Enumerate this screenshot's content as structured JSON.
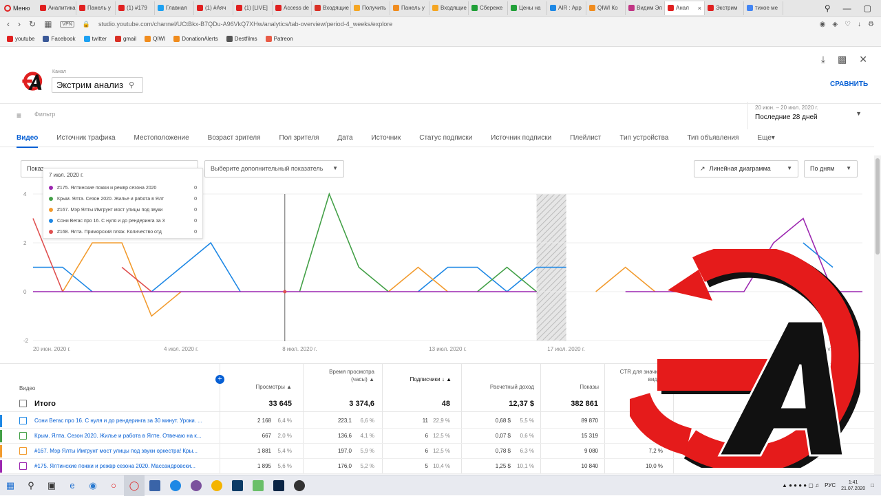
{
  "browser": {
    "menu_label": "Меню",
    "tabs": [
      {
        "label": "Аналитика",
        "color": "#e02020"
      },
      {
        "label": "Панель у",
        "color": "#e02020"
      },
      {
        "label": "(1) #179",
        "color": "#e02020"
      },
      {
        "label": "Главная",
        "color": "#1da1f2"
      },
      {
        "label": "(1) #Аяч",
        "color": "#e02020"
      },
      {
        "label": "(1) [LIVE]",
        "color": "#e02020"
      },
      {
        "label": "Access de",
        "color": "#e02020"
      },
      {
        "label": "Входящие",
        "color": "#d93025"
      },
      {
        "label": "Получить",
        "color": "#f5a623"
      },
      {
        "label": "Панель у",
        "color": "#f08c1e"
      },
      {
        "label": "Входящие",
        "color": "#f5a623"
      },
      {
        "label": "Сбереже",
        "color": "#21a038"
      },
      {
        "label": "Цены на",
        "color": "#21a038"
      },
      {
        "label": "AIR : App",
        "color": "#1e88e5"
      },
      {
        "label": "QIWI Ко",
        "color": "#f08c1e"
      },
      {
        "label": "Видим Эл",
        "color": "#c13584"
      },
      {
        "label": "Анал",
        "color": "#e02020",
        "active": true
      },
      {
        "label": "Экстрим",
        "color": "#e02020"
      },
      {
        "label": "тихое ме",
        "color": "#4285f4"
      }
    ],
    "url": "studio.youtube.com/channel/UCtBkx-B7QDu-A96VkQ7XHw/analytics/tab-overview/period-4_weeks/explore",
    "vpn_label": "VPN",
    "bookmarks": [
      {
        "label": "youtube",
        "color": "#e02020"
      },
      {
        "label": "Facebook",
        "color": "#3b5998"
      },
      {
        "label": "twitter",
        "color": "#1da1f2"
      },
      {
        "label": "gmail",
        "color": "#d93025"
      },
      {
        "label": "QIWI",
        "color": "#f08c1e"
      },
      {
        "label": "DonationAlerts",
        "color": "#f08c1e"
      },
      {
        "label": "Destfilms",
        "color": "#555555"
      },
      {
        "label": "Patreon",
        "color": "#e85b46"
      }
    ]
  },
  "studio": {
    "channel_label": "Канал",
    "channel_name": "Экстрим анализ",
    "compare_label": "СРАВНИТЬ",
    "filter_placeholder": "Фильтр",
    "date_range_sub": "20 июн. – 20 июл. 2020 г.",
    "date_range_main": "Последние 28 дней"
  },
  "dimension_tabs": [
    "Видео",
    "Источник трафика",
    "Местоположение",
    "Возраст зрителя",
    "Пол зрителя",
    "Дата",
    "Источник",
    "Статус подписки",
    "Источник подписки",
    "Плейлист",
    "Тип устройства",
    "Тип объявления",
    "Еще"
  ],
  "controls": {
    "metric": "Показ",
    "extra_metric": "Выберите дополнительный показатель",
    "chart_type": "Линейная диаграмма",
    "period": "По дням"
  },
  "tooltip": {
    "date": "7 июл. 2020 г.",
    "rows": [
      {
        "name": "#175. Ялтинские пожки и режвр сезона 2020",
        "value": "0",
        "color": "#9c27b0"
      },
      {
        "name": "Крым. Ялта. Сезон 2020. Жилье и работа в Ялт",
        "value": "0",
        "color": "#43a047"
      },
      {
        "name": "#167. Мэр Ялты Имгрунт мост улицы под звуки",
        "value": "0",
        "color": "#f29b2e"
      },
      {
        "name": "Сони Вегас про 16. С нуля и до рендеринга за 3",
        "value": "0",
        "color": "#1e88e5"
      },
      {
        "name": "#168. Ялта. Приморский пляж. Количество отд",
        "value": "0",
        "color": "#e05050"
      }
    ]
  },
  "chart_data": {
    "type": "line",
    "y_ticks": [
      "4",
      "2",
      "0",
      "-2"
    ],
    "ylim": [
      -2,
      4
    ],
    "x_tick_labels": [
      {
        "label": "20 июн. 2020 г.",
        "index": 0
      },
      {
        "label": "4 июл. 2020 г.",
        "index": 5
      },
      {
        "label": "8 июл. 2020 г.",
        "index": 9
      },
      {
        "label": "13 июл. 2020 г.",
        "index": 14
      },
      {
        "label": "17 июл. 2020 г.",
        "index": 18
      },
      {
        "label": "20 июл. 2020 г.",
        "index": 27
      }
    ],
    "hover_index": 8,
    "shaded_index": [
      17,
      18
    ],
    "series": [
      {
        "name": "Сони Вегас про 16",
        "color": "#1e88e5",
        "values": [
          1,
          1,
          0,
          null,
          0,
          1,
          2,
          0,
          null,
          null,
          null,
          null,
          null,
          0,
          1,
          1,
          0,
          1,
          1,
          null,
          null,
          null,
          null,
          null,
          null,
          null,
          2,
          1,
          null
        ]
      },
      {
        "name": "Крым. Ялта. Сезон 2020",
        "color": "#43a047",
        "values": [
          null,
          null,
          null,
          null,
          null,
          null,
          null,
          null,
          null,
          0,
          4,
          1,
          0,
          null,
          null,
          0,
          1,
          0,
          null,
          null,
          null,
          null,
          0,
          0,
          null,
          null,
          null,
          null,
          null
        ]
      },
      {
        "name": "#167. Мэр Ялты",
        "color": "#f29b2e",
        "values": [
          null,
          0,
          2,
          2,
          -1,
          0,
          null,
          null,
          null,
          null,
          null,
          null,
          0,
          1,
          0,
          null,
          null,
          null,
          null,
          0,
          1,
          0,
          null,
          null,
          null,
          null,
          null,
          null,
          null
        ]
      },
      {
        "name": "#168. Ялта. Приморский пляж",
        "color": "#e05050",
        "values": [
          3,
          0,
          null,
          1,
          0,
          null,
          null,
          null,
          null,
          null,
          null,
          null,
          null,
          null,
          null,
          null,
          null,
          null,
          null,
          null,
          null,
          null,
          null,
          null,
          null,
          null,
          null,
          null,
          null
        ]
      },
      {
        "name": "#175. Ялтинские пожки",
        "color": "#9c27b0",
        "values": [
          0,
          0,
          0,
          0,
          0,
          0,
          0,
          0,
          0,
          0,
          0,
          0,
          0,
          0,
          0,
          0,
          0,
          0,
          null,
          null,
          0,
          0,
          0,
          0,
          0,
          2,
          3,
          0,
          0
        ]
      }
    ]
  },
  "table": {
    "headers": {
      "video": "Видео",
      "views": "Просмотры",
      "watch_time": "Время просмотра (часы)",
      "subs": "Подписчики",
      "revenue": "Расчетный доход",
      "impressions": "Показы",
      "ctr": "CTR для значков видео"
    },
    "total": {
      "label": "Итого",
      "views": "33 645",
      "watch_time": "3 374,6",
      "subs": "48",
      "revenue": "12,37 $",
      "impressions": "382 861"
    },
    "rows": [
      {
        "title": "Сони Вегас про 16. С нуля и до рендеринга за 30 минут. Уроки. ...",
        "color": "#1e88e5",
        "views": "2 168",
        "views_pct": "6,4 %",
        "wt": "223,1",
        "wt_pct": "6,6 %",
        "subs": "11",
        "subs_pct": "22,9 %",
        "rev": "0,68 $",
        "rev_pct": "5,5 %",
        "imp": "89 870",
        "ctr": ""
      },
      {
        "title": "Крым. Ялта. Сезон 2020. Жилье и работа в Ялте. Отвечаю на к...",
        "color": "#43a047",
        "views": "667",
        "views_pct": "2,0 %",
        "wt": "136,6",
        "wt_pct": "4,1 %",
        "subs": "6",
        "subs_pct": "12,5 %",
        "rev": "0,07 $",
        "rev_pct": "0,6 %",
        "imp": "15 319",
        "ctr": ""
      },
      {
        "title": "#167. Мэр Ялты Имгрунт мост улицы под звуки оркестра! Кры...",
        "color": "#f29b2e",
        "views": "1 881",
        "views_pct": "5,4 %",
        "wt": "197,0",
        "wt_pct": "5,9 %",
        "subs": "6",
        "subs_pct": "12,5 %",
        "rev": "0,78 $",
        "rev_pct": "6,3 %",
        "imp": "9 080",
        "ctr": "7,2 %"
      },
      {
        "title": "#175. Ялтинские пожки и режвр сезона 2020. Массандровски...",
        "color": "#9c27b0",
        "views": "1 895",
        "views_pct": "5,6 %",
        "wt": "176,0",
        "wt_pct": "5,2 %",
        "subs": "5",
        "subs_pct": "10,4 %",
        "rev": "1,25 $",
        "rev_pct": "10,1 %",
        "imp": "10 840",
        "ctr": "10,0 %"
      }
    ]
  },
  "taskbar": {
    "lang": "РУС",
    "time": "1:41",
    "date": "21.07.2020"
  }
}
